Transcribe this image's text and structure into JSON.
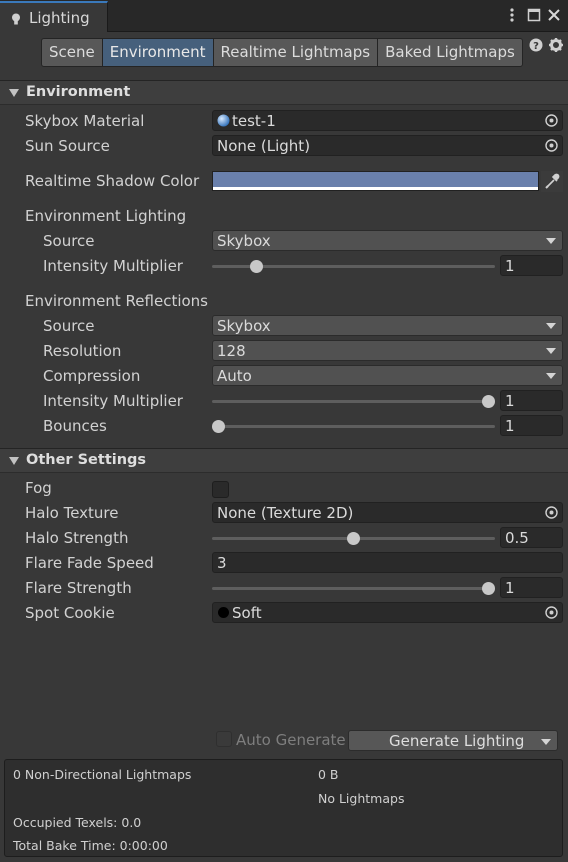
{
  "window": {
    "title": "Lighting",
    "buttons": [
      "more-vertical",
      "maximize",
      "close"
    ]
  },
  "toolbar": {
    "tabs": [
      "Scene",
      "Environment",
      "Realtime Lightmaps",
      "Baked Lightmaps"
    ],
    "active_tab": "Environment"
  },
  "environment": {
    "header": "Environment",
    "skybox_material": {
      "label": "Skybox Material",
      "value": "test-1"
    },
    "sun_source": {
      "label": "Sun Source",
      "value": "None (Light)"
    },
    "shadow_color": {
      "label": "Realtime Shadow Color",
      "color": "#6a80ac"
    },
    "lighting": {
      "header": "Environment Lighting",
      "source_label": "Source",
      "source_value": "Skybox",
      "intensity_label": "Intensity Multiplier",
      "intensity_value": "1",
      "intensity_fraction": 0.14
    },
    "reflections": {
      "header": "Environment Reflections",
      "source_label": "Source",
      "source_value": "Skybox",
      "resolution_label": "Resolution",
      "resolution_value": "128",
      "compression_label": "Compression",
      "compression_value": "Auto",
      "intensity_label": "Intensity Multiplier",
      "intensity_value": "1",
      "intensity_fraction": 1.0,
      "bounces_label": "Bounces",
      "bounces_value": "1",
      "bounces_fraction": 0.0
    }
  },
  "other": {
    "header": "Other Settings",
    "fog_label": "Fog",
    "fog_checked": false,
    "halo_texture_label": "Halo Texture",
    "halo_texture_value": "None (Texture 2D)",
    "halo_strength_label": "Halo Strength",
    "halo_strength_value": "0.5",
    "halo_strength_fraction": 0.5,
    "flare_fade_label": "Flare Fade Speed",
    "flare_fade_value": "3",
    "flare_strength_label": "Flare Strength",
    "flare_strength_value": "1",
    "flare_strength_fraction": 1.0,
    "spot_cookie_label": "Spot Cookie",
    "spot_cookie_value": "Soft"
  },
  "bottom": {
    "auto_generate_label": "Auto Generate",
    "auto_generate_checked": false,
    "generate_button": "Generate Lighting"
  },
  "stats": {
    "non_directional": "0 Non-Directional Lightmaps",
    "size": "0 B",
    "no_lightmaps": "No Lightmaps",
    "occupied": "Occupied Texels: 0.0",
    "bake_time": "Total Bake Time: 0:00:00"
  },
  "colors": {
    "accent": "#3a79bb",
    "active_tab": "#46607c",
    "panel_bg": "#383838"
  }
}
